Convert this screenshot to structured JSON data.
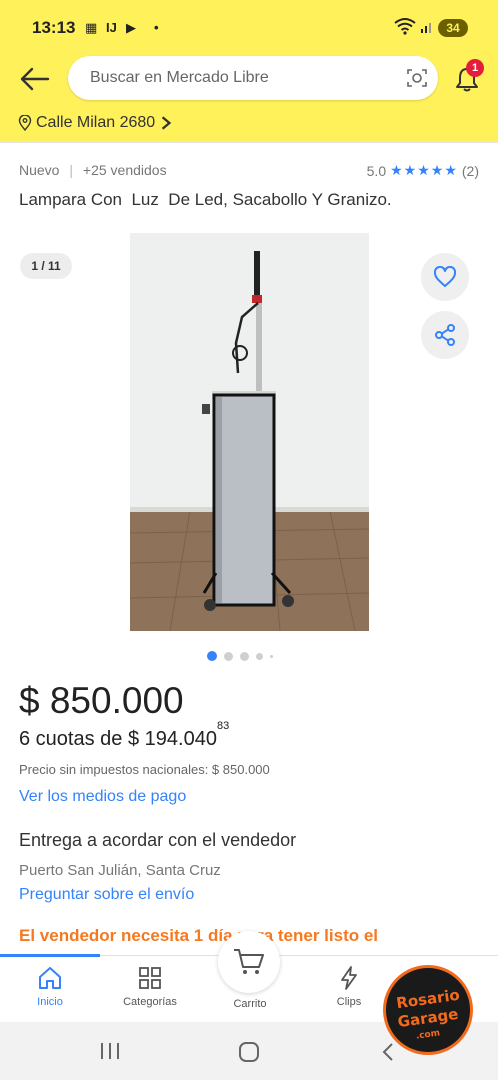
{
  "status_bar": {
    "time": "13:13",
    "battery": "34"
  },
  "header": {
    "search_placeholder": "Buscar en Mercado Libre",
    "notification_count": "1",
    "address": "Calle Milan 2680"
  },
  "product": {
    "condition": "Nuevo",
    "sold": "+25 vendidos",
    "rating_value": "5.0",
    "rating_count": "(2)",
    "title": "Lampara Con  Luz  De Led, Sacabollo Y Granizo.",
    "image_counter": "1 / 11",
    "gallery_total": 11,
    "gallery_current": 1,
    "price": "$ 850.000",
    "installments_text": "6 cuotas de $ 194.040",
    "installments_cents": "83",
    "tax_note": "Precio sin impuestos nacionales: $ 850.000",
    "payment_link": "Ver los medios de pago",
    "delivery": "Entrega a acordar con el vendedor",
    "location": "Puerto San Julián, Santa Cruz",
    "shipping_link": "Preguntar sobre el envío",
    "seller_notice": "El vendedor necesita 1 día para tener listo el"
  },
  "bottom_nav": {
    "items": [
      {
        "label": "Inicio",
        "icon": "home-icon"
      },
      {
        "label": "Categorías",
        "icon": "grid-icon"
      },
      {
        "label": "Carrito",
        "icon": "cart-icon"
      },
      {
        "label": "Clips",
        "icon": "lightning-icon"
      }
    ]
  },
  "watermark": {
    "line1": "Rosario",
    "line2": "Garage",
    "line3": ".com"
  },
  "colors": {
    "brand_yellow": "#fff159",
    "accent_blue": "#3483fa",
    "notice_orange": "#f47a22",
    "badge_red": "#e41e3a"
  }
}
